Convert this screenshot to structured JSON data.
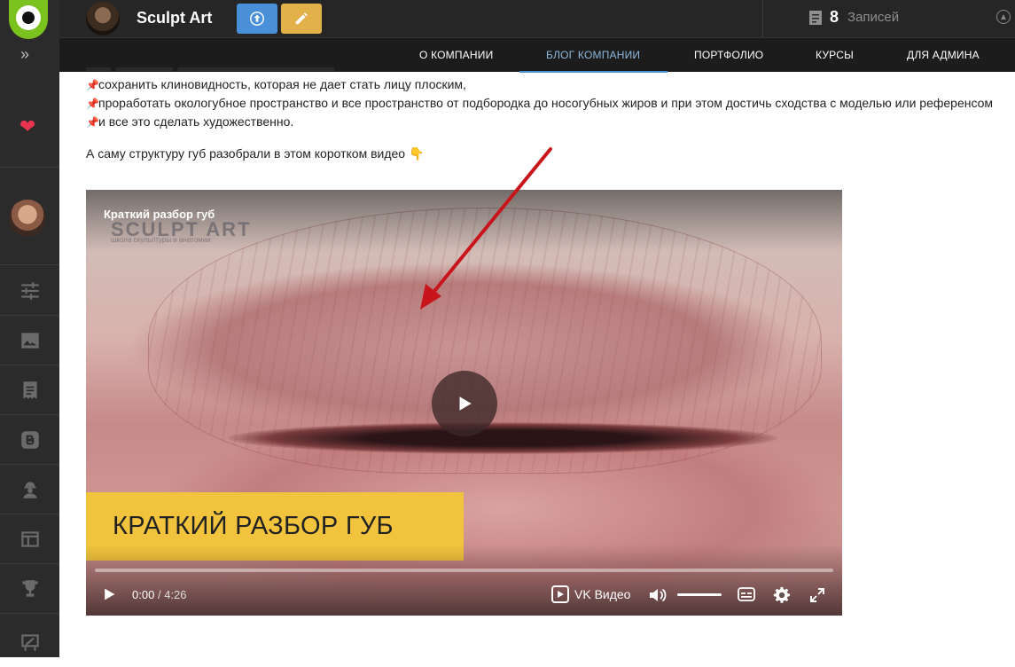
{
  "brand": {
    "title": "Sculpt Art"
  },
  "header": {
    "records_count": "8",
    "records_label": "Записей"
  },
  "nav": [
    {
      "label": "О КОМПАНИИ",
      "active": false
    },
    {
      "label": "БЛОГ КОМПАНИИ",
      "active": true
    },
    {
      "label": "ПОРТФОЛИО",
      "active": false
    },
    {
      "label": "КУРСЫ",
      "active": false
    },
    {
      "label": "ДЛЯ АДМИНА",
      "active": false
    }
  ],
  "content": {
    "bullets": [
      "сохранить клиновидность, которая не дает стать лицу плоским,",
      "проработать окологубное пространство и все пространство от подбородка до носогубных жиров и при этом достичь сходства с моделью или референсом",
      "и все это сделать художественно."
    ],
    "intro": "А саму структуру губ разобрали в этом коротком видео 👇"
  },
  "video": {
    "title": "Краткий разбор губ",
    "watermark": "SCULPT ART",
    "watermark_sub": "школа скульптуры и анатомии",
    "banner_text": "КРАТКИЙ РАЗБОР ГУБ",
    "time_current": "0:00",
    "time_separator": "/",
    "time_total": "4:26",
    "provider": "VK Видео",
    "progress": 0
  },
  "icons": {
    "sidebar": [
      "sliders-icon",
      "image-icon",
      "document-icon",
      "blogger-icon",
      "worker-icon",
      "layout-icon",
      "trophy-icon",
      "easel-icon"
    ]
  },
  "colors": {
    "accent": "#4a90d9",
    "logo": "#7cc21e",
    "edit": "#e3b14a",
    "heart": "#e8344e",
    "banner": "#f2c43e",
    "arrow": "#c8151b"
  }
}
